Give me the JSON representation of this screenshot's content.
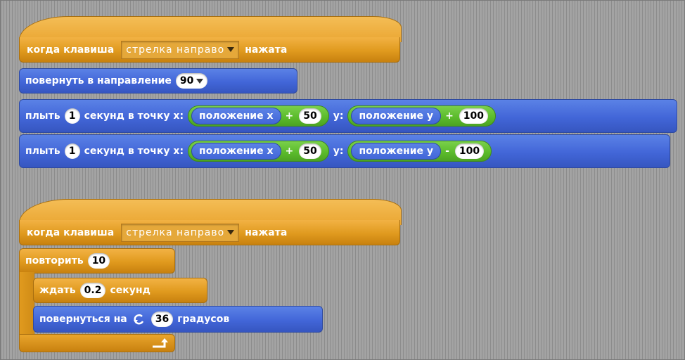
{
  "script1": {
    "when_key_label": "когда клавиша",
    "key_option": "стрелка направо",
    "pressed_label": "нажата",
    "point_label": "повернуть в направление",
    "point_value": "90",
    "glide_rows": [
      {
        "glide_label": "плыть",
        "secs": "1",
        "to_label": "секунд в точку x:",
        "x_reporter": "положение x",
        "x_op": "+",
        "x_value": "50",
        "y_label": "y:",
        "y_reporter": "положение y",
        "y_op": "+",
        "y_value": "100"
      },
      {
        "glide_label": "плыть",
        "secs": "1",
        "to_label": "секунд в точку x:",
        "x_reporter": "положение x",
        "x_op": "+",
        "x_value": "50",
        "y_label": "y:",
        "y_reporter": "положение y",
        "y_op": "-",
        "y_value": "100"
      }
    ]
  },
  "script2": {
    "when_key_label": "когда клавиша",
    "key_option": "стрелка направо",
    "pressed_label": "нажата",
    "repeat_label": "повторить",
    "repeat_value": "10",
    "wait_label": "ждать",
    "wait_value": "0.2",
    "wait_unit": "секунд",
    "turn_label": "повернуться на",
    "turn_value": "36",
    "turn_unit": "градусов"
  },
  "colors": {
    "events": "#e09a1e",
    "motion": "#4266d8",
    "operators": "#5cbc2c",
    "canvas": "#9a9a9a"
  },
  "icons": {
    "dropdown": "dropdown-triangle-icon",
    "turn": "rotate-clockwise-icon",
    "loop": "loop-return-arrow-icon"
  }
}
